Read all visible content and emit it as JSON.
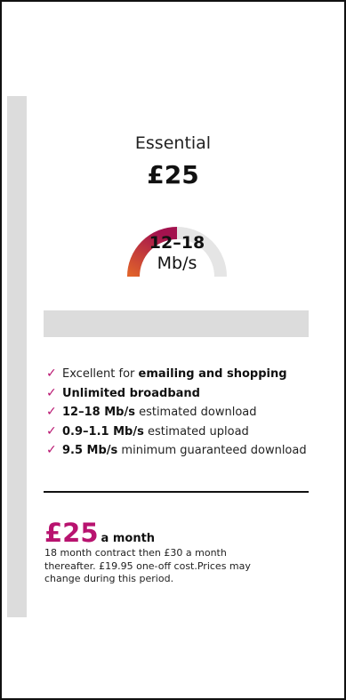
{
  "plan": {
    "name": "Essential",
    "price": "£25",
    "speed": "12–18",
    "speed_unit": "Mb/s"
  },
  "features": [
    {
      "pre": "Excellent for ",
      "bold": "emailing and shopping",
      "post": ""
    },
    {
      "pre": "",
      "bold": "Unlimited broadband",
      "post": ""
    },
    {
      "pre": "",
      "bold": "12–18 Mb/s",
      "post": " estimated download"
    },
    {
      "pre": "",
      "bold": "0.9–1.1 Mb/s",
      "post": " estimated upload"
    },
    {
      "pre": "",
      "bold": "9.5 Mb/s",
      "post": " minimum guaranteed download"
    }
  ],
  "pricing": {
    "amount": "£25",
    "period": "a month",
    "terms": "18 month contract then £30 a month thereafter. £19.95 one-off cost.Prices may change during this period."
  },
  "colors": {
    "accent": "#b8136f",
    "gauge_start": "#e0622a",
    "gauge_end": "#a3124e",
    "gauge_track": "#e5e5e5"
  },
  "gauge_fill_fraction": 0.5
}
